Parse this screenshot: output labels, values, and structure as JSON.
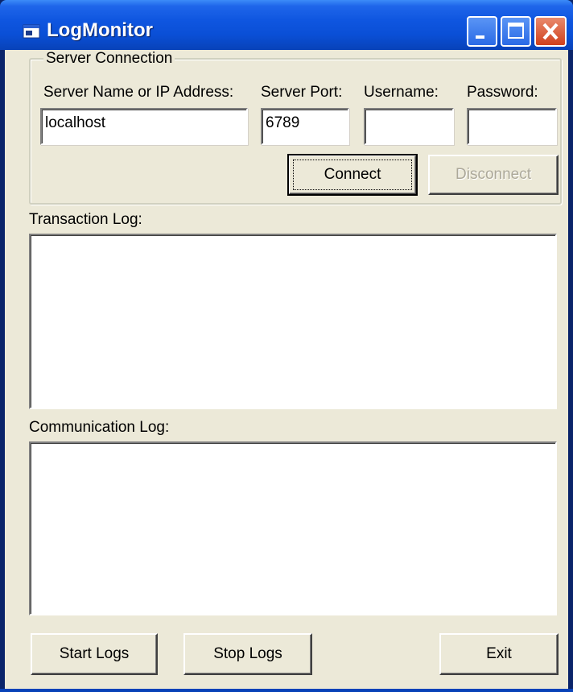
{
  "window": {
    "title": "LogMonitor",
    "icon": "app-window-icon",
    "controls": [
      "minimize-icon",
      "maximize-icon",
      "close-icon"
    ]
  },
  "server_connection": {
    "group_label": "Server Connection",
    "server_name_label": "Server Name or IP Address:",
    "server_name_value": "localhost",
    "port_label": "Server Port:",
    "port_value": "6789",
    "username_label": "Username:",
    "username_value": "",
    "password_label": "Password:",
    "password_value": "",
    "connect_label": "Connect",
    "disconnect_label": "Disconnect"
  },
  "transaction_log": {
    "label": "Transaction Log:"
  },
  "communication_log": {
    "label": "Communication Log:"
  },
  "footer": {
    "start_label": "Start Logs",
    "stop_label": "Stop Logs",
    "exit_label": "Exit"
  },
  "colors": {
    "titlebar": "#0a4fd6",
    "client_bg": "#ece9d8",
    "close_button": "#d0401c",
    "disabled_text": "#aca899"
  }
}
